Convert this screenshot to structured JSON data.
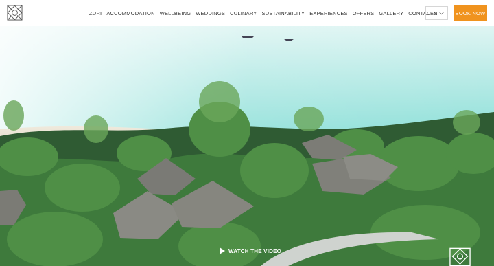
{
  "header": {
    "logo_icon": "resort-logo-icon",
    "nav": [
      {
        "label": "ZURI"
      },
      {
        "label": "ACCOMMODATION"
      },
      {
        "label": "WELLBEING"
      },
      {
        "label": "WEDDINGS"
      },
      {
        "label": "CULINARY"
      },
      {
        "label": "SUSTAINABILITY"
      },
      {
        "label": "EXPERIENCES"
      },
      {
        "label": "OFFERS"
      },
      {
        "label": "GALLERY"
      },
      {
        "label": "CONTACTS"
      }
    ],
    "language": "EN",
    "book_label": "BOOK NOW",
    "accent_color": "#f0931e"
  },
  "hero": {
    "watch_label": "WATCH THE VIDEO",
    "play_icon": "play-icon",
    "corner_icon": "resort-logo-icon"
  }
}
